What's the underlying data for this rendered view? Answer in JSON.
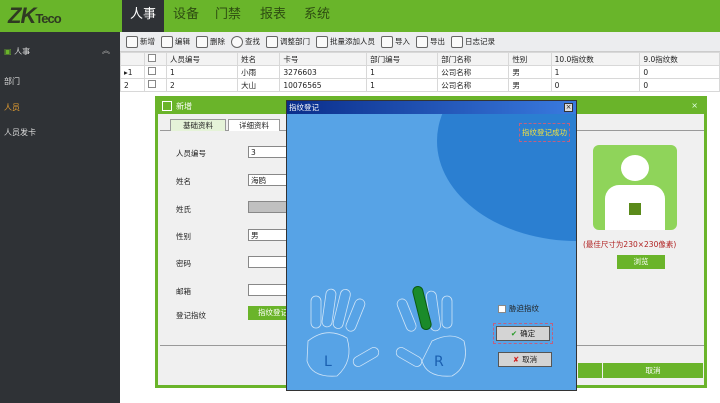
{
  "logo": "ZKTeco",
  "nav": [
    "人事",
    "设备",
    "门禁",
    "报表",
    "系统"
  ],
  "sidebar": {
    "section": "人事",
    "items": [
      "部门",
      "人员",
      "人员发卡"
    ]
  },
  "toolbar": [
    "新增",
    "编辑",
    "删除",
    "查找",
    "调整部门",
    "批量添加人员",
    "导入",
    "导出",
    "日志记录"
  ],
  "table": {
    "headers": [
      "人员编号",
      "姓名",
      "卡号",
      "部门编号",
      "部门名称",
      "性别",
      "10.0指纹数",
      "9.0指纹数"
    ],
    "rows": [
      {
        "idx": "1",
        "cells": [
          "1",
          "小雨",
          "3276603",
          "1",
          "公司名称",
          "男",
          "1",
          "0"
        ]
      },
      {
        "idx": "2",
        "cells": [
          "2",
          "大山",
          "10076565",
          "1",
          "公司名称",
          "男",
          "0",
          "0"
        ]
      }
    ]
  },
  "add_dialog": {
    "title": "新增",
    "tabs": [
      "基础资料",
      "详细资料"
    ],
    "fields": [
      {
        "label": "人员编号",
        "value": "3"
      },
      {
        "label": "姓名",
        "value": "海鸥"
      },
      {
        "label": "姓氏",
        "value": ""
      },
      {
        "label": "性别",
        "value": "男"
      },
      {
        "label": "密码",
        "value": ""
      },
      {
        "label": "邮箱",
        "value": ""
      }
    ],
    "fp_label": "登记指纹",
    "fp_button": "指纹登记",
    "photo_hint": "(最佳尺寸为230×230像素)",
    "browse": "浏览",
    "cancel": "取消"
  },
  "fp_dialog": {
    "title": "指纹登记",
    "status": "指纹登记成功",
    "left": "L",
    "right": "R",
    "duress": "胁迫指纹",
    "ok": "确定",
    "cancel": "取消"
  }
}
